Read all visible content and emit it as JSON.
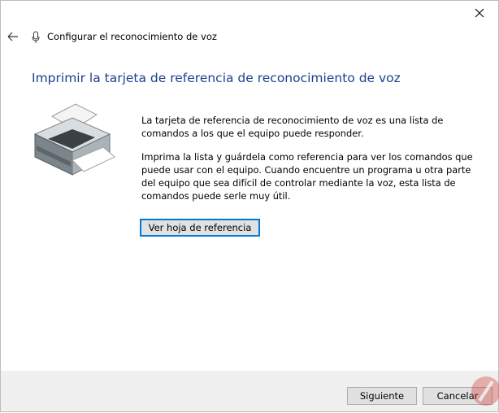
{
  "window": {
    "title": "Configurar el reconocimiento de voz",
    "close_glyph": "✕"
  },
  "icons": {
    "back": "back-arrow-icon",
    "title": "microphone-icon",
    "illustration": "printer-icon",
    "close": "close-icon"
  },
  "main": {
    "heading": "Imprimir la tarjeta de referencia de reconocimiento de voz",
    "paragraph1": "La tarjeta de referencia de reconocimiento de voz es una lista de comandos a los que el equipo puede responder.",
    "paragraph2": "Imprima la lista y guárdela como referencia para ver los comandos que puede usar con el equipo. Cuando encuentre un programa u otra parte del equipo que sea difícil de controlar mediante la voz, esta lista de comandos puede serle muy útil.",
    "reference_button": "Ver hoja de referencia"
  },
  "footer": {
    "next_label": "Siguiente",
    "cancel_label": "Cancelar"
  },
  "colors": {
    "heading": "#1f3f8f",
    "accent_border": "#0078d7",
    "footer_bg": "#f0f0f0"
  }
}
